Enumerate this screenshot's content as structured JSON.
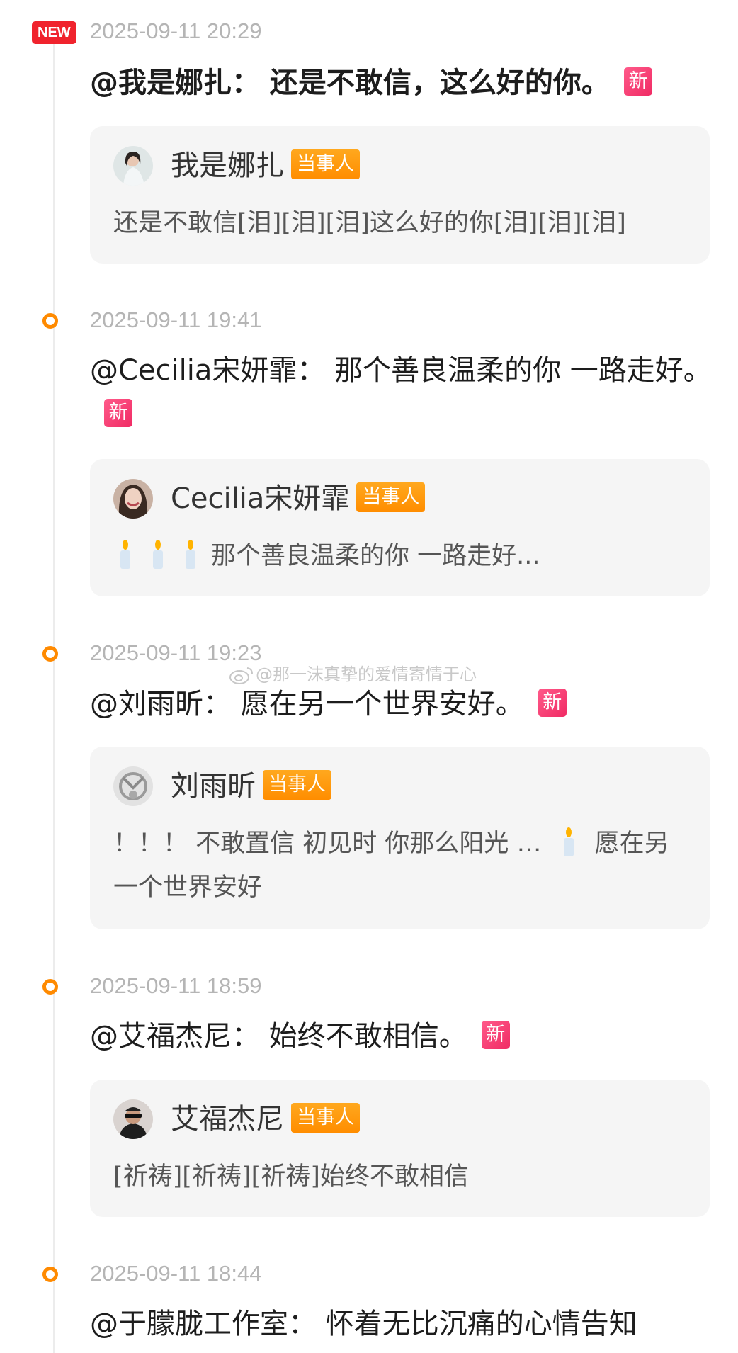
{
  "new_label": "NEW",
  "xin_label": "新",
  "tag_label": "当事人",
  "watermark": "@那一沫真挚的爱情寄情于心",
  "entries": [
    {
      "timestamp": "2025-09-11 20:29",
      "headline": "@我是娜扎： 还是不敢信，这么好的你。",
      "name": "我是娜扎",
      "text": "还是不敢信[泪][泪][泪]这么好的你[泪][泪][泪]"
    },
    {
      "timestamp": "2025-09-11 19:41",
      "headline": "@Cecilia宋妍霏： 那个善良温柔的你 一路走好。",
      "name": "Cecilia宋妍霏",
      "text": "那个善良温柔的你 一路走好..."
    },
    {
      "timestamp": "2025-09-11 19:23",
      "headline": "@刘雨昕： 愿在另一个世界安好。",
      "name": "刘雨昕",
      "text_part1": "！！！ 不敢置信 初见时 你那么阳光 …",
      "text_part2": "愿在另一个世界安好"
    },
    {
      "timestamp": "2025-09-11 18:59",
      "headline": "@艾福杰尼： 始终不敢相信。",
      "name": "艾福杰尼",
      "text": "[祈祷][祈祷][祈祷]始终不敢相信"
    },
    {
      "timestamp": "2025-09-11 18:44",
      "headline": "@于朦胧工作室： 怀着无比沉痛的心情告知"
    }
  ],
  "colors": {
    "accent_orange": "#ff8a00",
    "new_red": "#f0232d",
    "xin_pink": "#f02b64",
    "card_bg": "#f5f5f5",
    "timestamp_gray": "#b5b5b5"
  }
}
